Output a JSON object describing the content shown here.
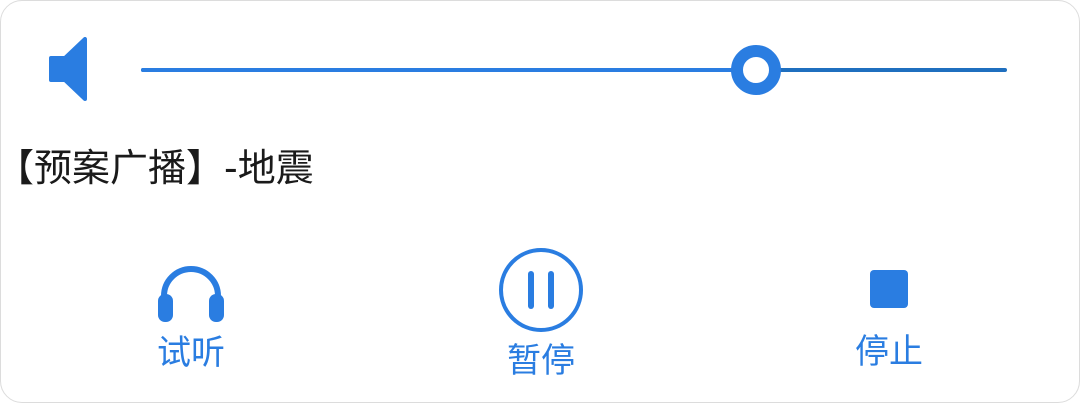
{
  "volume": {
    "icon": "speaker-icon",
    "level": 0.71
  },
  "broadcast": {
    "title": "【预案广播】-地震"
  },
  "controls": {
    "listen": {
      "icon": "headphones-icon",
      "label": "试听"
    },
    "pause": {
      "icon": "pause-circle-icon",
      "label": "暂停"
    },
    "stop": {
      "icon": "stop-square-icon",
      "label": "停止"
    }
  },
  "colors": {
    "accent": "#2a7de1",
    "track": "#1f6fbf",
    "text": "#1a1a1a"
  }
}
